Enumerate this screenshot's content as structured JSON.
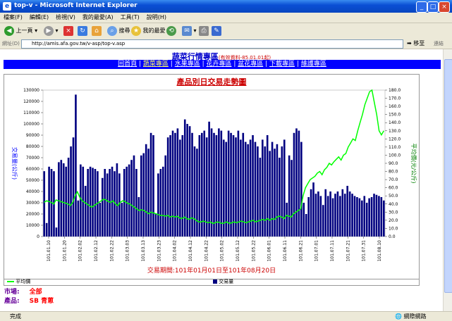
{
  "window": {
    "title": "top-v - Microsoft Internet Explorer"
  },
  "menu": [
    "檔案(F)",
    "編輯(E)",
    "檢視(V)",
    "我的最愛(A)",
    "工具(T)",
    "說明(H)"
  ],
  "toolbar": {
    "back": "上一頁",
    "search": "搜尋",
    "favorites": "我的最愛"
  },
  "address": {
    "label": "網址(D)",
    "url": "http://amis.afa.gov.tw/v-asp/top-v.asp",
    "go": "移至",
    "links": "連結"
  },
  "page": {
    "heading": "蔬菜行情專區",
    "heading_note": "(有效資料-85.01.01起)",
    "nav": [
      "回首頁",
      "蔬菜專區",
      "水果專區",
      "花卉專區",
      "盆花專區",
      "下載專區",
      "維護專區"
    ],
    "market_label": "市場:",
    "market_value": "全部",
    "product_label": "產品:",
    "product_value": "SB 青蔥"
  },
  "status": {
    "text": "完成",
    "zone": "網際網路"
  },
  "colors": {
    "bar": "#000080",
    "line": "#00ff00",
    "nav_bg": "#0000ff",
    "title": "#cc0000"
  },
  "chart_data": {
    "type": "bar",
    "title": "產品別日交易走勢圖",
    "date_range": "交易期間:101年01月01日至101年08月20日",
    "ylabel_left": "交易量(公斤)",
    "ylabel_right": "平均價(元/公斤)",
    "ylim_left": [
      0,
      130000
    ],
    "yticks_left": [
      "0",
      "10000",
      "20000",
      "30000",
      "40000",
      "50000",
      "60000",
      "70000",
      "80000",
      "90000",
      "100000",
      "110000",
      "120000",
      "130000"
    ],
    "ylim_right": [
      0,
      180
    ],
    "yticks_right": [
      "0.0",
      "10.0",
      "20.0",
      "30.0",
      "40.0",
      "50.0",
      "60.0",
      "70.0",
      "80.0",
      "90.0",
      "100.0",
      "110.0",
      "120.0",
      "130.0",
      "140.0",
      "150.0",
      "160.0",
      "170.0",
      "180.0"
    ],
    "x_labels": [
      "101.01.10",
      "101.01.20",
      "101.02.02",
      "101.02.12",
      "101.02.22",
      "101.03.03",
      "101.03.13",
      "101.03.23",
      "101.04.02",
      "101.04.12",
      "101.04.22",
      "101.05.02",
      "101.05.12",
      "101.05.22",
      "101.06.01",
      "101.06.11",
      "101.06.21",
      "101.07.01",
      "101.07.11",
      "101.07.21",
      "101.07.31",
      "101.08.10"
    ],
    "series": [
      {
        "name": "交易量",
        "type": "bar",
        "axis": "left",
        "values": [
          58000,
          12000,
          62000,
          60000,
          58000,
          8000,
          66000,
          68000,
          65000,
          62000,
          70000,
          80000,
          88000,
          126000,
          32000,
          64000,
          62000,
          45000,
          60000,
          62000,
          61000,
          60000,
          58000,
          30000,
          52000,
          60000,
          56000,
          60000,
          62000,
          58000,
          65000,
          56000,
          30000,
          60000,
          62000,
          64000,
          68000,
          72000,
          60000,
          35000,
          72000,
          74000,
          82000,
          78000,
          92000,
          90000,
          20000,
          56000,
          60000,
          62000,
          72000,
          88000,
          90000,
          94000,
          92000,
          96000,
          86000,
          90000,
          104000,
          100000,
          98000,
          92000,
          80000,
          78000,
          90000,
          92000,
          94000,
          88000,
          102000,
          96000,
          92000,
          90000,
          96000,
          94000,
          86000,
          84000,
          94000,
          92000,
          90000,
          88000,
          94000,
          86000,
          92000,
          84000,
          82000,
          86000,
          90000,
          84000,
          80000,
          70000,
          86000,
          80000,
          90000,
          76000,
          84000,
          78000,
          82000,
          70000,
          80000,
          86000,
          30000,
          72000,
          68000,
          92000,
          96000,
          94000,
          84000,
          30000,
          20000,
          35000,
          42000,
          48000,
          38000,
          40000,
          36000,
          28000,
          42000,
          36000,
          40000,
          34000,
          38000,
          40000,
          36000,
          42000,
          38000,
          45000,
          40000,
          38000,
          36000,
          35000,
          34000,
          32000,
          36000,
          30000,
          34000,
          35000,
          38000,
          37000,
          36000,
          35000,
          32000
        ]
      },
      {
        "name": "平均價",
        "type": "line",
        "axis": "right",
        "values": [
          42,
          44,
          43,
          42,
          40,
          45,
          44,
          43,
          42,
          41,
          40,
          38,
          42,
          50,
          55,
          48,
          44,
          42,
          40,
          38,
          36,
          38,
          40,
          42,
          44,
          46,
          45,
          43,
          42,
          44,
          40,
          38,
          42,
          44,
          43,
          41,
          40,
          38,
          36,
          34,
          32,
          33,
          32,
          30,
          28,
          30,
          29,
          28,
          27,
          26,
          26,
          25,
          26,
          24,
          25,
          24,
          25,
          23,
          22,
          24,
          22,
          21,
          23,
          22,
          20,
          18,
          18,
          19,
          18,
          17,
          18,
          16,
          17,
          18,
          17,
          16,
          17,
          18,
          16,
          17,
          18,
          17,
          18,
          19,
          18,
          17,
          18,
          19,
          20,
          18,
          19,
          20,
          21,
          20,
          22,
          20,
          22,
          21,
          24,
          25,
          24,
          22,
          26,
          25,
          24,
          28,
          30,
          32,
          34,
          50,
          60,
          65,
          70,
          72,
          74,
          78,
          80,
          76,
          82,
          85,
          90,
          88,
          92,
          95,
          98,
          94,
          100,
          102,
          110,
          115,
          120,
          118,
          130,
          140,
          150,
          162,
          170,
          178,
          180,
          165,
          150,
          130,
          125,
          130
        ]
      }
    ]
  }
}
